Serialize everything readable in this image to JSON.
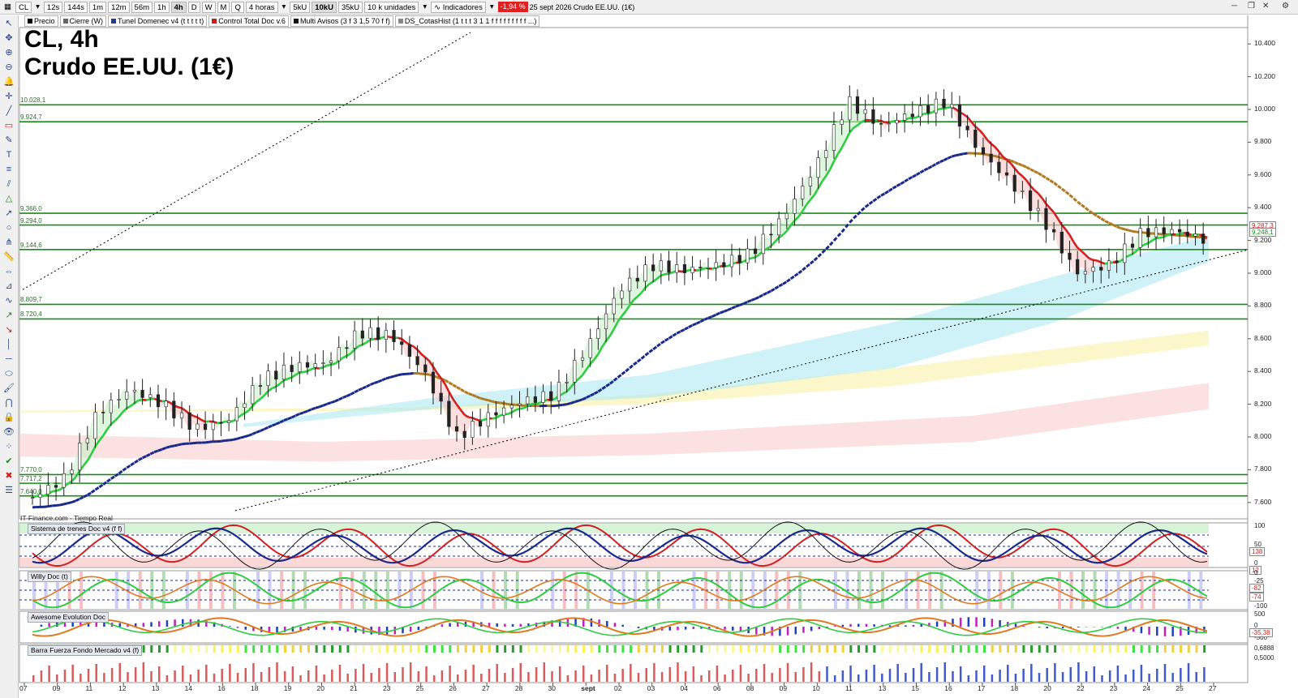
{
  "toolbar": {
    "symbol": "CL",
    "timeframes": [
      "12s",
      "144s",
      "1m",
      "12m",
      "56m",
      "1h",
      "4h",
      "D",
      "W",
      "M",
      "Q"
    ],
    "active_timeframe": "4h",
    "period_select": "4 horas",
    "unit_buttons": [
      "5kU",
      "10kU",
      "35kU"
    ],
    "active_unit": "10kU",
    "units_select": "10 k unidades",
    "indicators_label": "Indicadores",
    "change_badge": "-1,94 %",
    "date_text": "25 sept 2026",
    "instrument_text": "Crudo EE.UU. (1€)",
    "overlays": [
      {
        "label": "Precio",
        "color": "#000000"
      },
      {
        "label": "Cierre (W)",
        "color": "#666666"
      },
      {
        "label": "Tunel Domenec v4 (t t t t t)",
        "color": "#2a3a8a"
      },
      {
        "label": "Control Total Doc v.6",
        "color": "#c02020"
      },
      {
        "label": "Multi Avisos (3 f 3 1,5 70 f f)",
        "color": "#111111"
      },
      {
        "label": "DS_CotasHist (1 t t t 3 1 1 f f f f f f f f f ...)",
        "color": "#888888"
      }
    ]
  },
  "chart": {
    "title_line1": "CL, 4h",
    "title_line2": "Crudo EE.UU. (1€)",
    "source": "IT-Finance.com - Tiempo Real",
    "price_ticks": [
      "10.400",
      "10.200",
      "10.000",
      "9.800",
      "9.600",
      "9.400",
      "9.200",
      "9.000",
      "8.800",
      "8.600",
      "8.400",
      "8.200",
      "8.000",
      "7.800",
      "7.600"
    ],
    "levels": [
      "10.028,1",
      "9.924,7",
      "9.366,0",
      "9.294,0",
      "9.144,6",
      "8.809,7",
      "8.720,4",
      "7.770,0",
      "7.717,2",
      "7.640,0"
    ],
    "price_tags": [
      "9.287,3",
      "9.248,1"
    ],
    "date_ticks": [
      "07",
      "09",
      "11",
      "12",
      "13",
      "14",
      "16",
      "18",
      "19",
      "20",
      "21",
      "23",
      "25",
      "26",
      "27",
      "28",
      "30",
      "sept",
      "02",
      "03",
      "04",
      "06",
      "08",
      "09",
      "10",
      "11",
      "13",
      "15",
      "16",
      "17",
      "18",
      "20",
      "22",
      "23",
      "24",
      "25",
      "27"
    ],
    "colors": {
      "support": "#1a8a1a",
      "bull": "#2ecc40",
      "bear": "#d02020",
      "trend": "#1a2a8a",
      "ema": "#b07a20"
    }
  },
  "chart_data": [
    {
      "type": "candlestick",
      "title": "CL, 4h",
      "subtitle": "Crudo EE.UU. (1€)",
      "ylim": [
        7500,
        10500
      ],
      "x": [
        "07",
        "09",
        "11",
        "12",
        "13",
        "14",
        "16",
        "18",
        "19",
        "20",
        "21",
        "23",
        "25",
        "26",
        "27",
        "28",
        "30",
        "sept",
        "02",
        "03",
        "04",
        "06",
        "08",
        "09",
        "10",
        "11",
        "13",
        "15",
        "16",
        "17",
        "18",
        "20",
        "22",
        "23",
        "24",
        "25",
        "27"
      ],
      "close": [
        7630,
        7750,
        8150,
        8290,
        8200,
        8050,
        8100,
        8350,
        8430,
        8450,
        8640,
        8620,
        8400,
        8000,
        8130,
        8220,
        8260,
        8550,
        8900,
        9050,
        9020,
        9050,
        9120,
        9340,
        9650,
        10050,
        9900,
        9980,
        10050,
        9750,
        9550,
        9320,
        9000,
        9050,
        9250,
        9260,
        9200
      ]
    },
    {
      "type": "line",
      "title": "Sistema de trenes Doc v4 (f f)",
      "ylim": [
        0,
        100
      ],
      "ticks": [
        "100",
        "50",
        "0"
      ],
      "value_tags": [
        "138",
        "12"
      ]
    },
    {
      "type": "line",
      "title": "Willy Doc (t)",
      "ylim": [
        -100,
        0
      ],
      "ticks": [
        "0",
        "-25",
        "-50",
        "-75",
        "-100"
      ],
      "value_tags": [
        "-82",
        "-74"
      ]
    },
    {
      "type": "bar",
      "title": "Awesome Evolution Doc",
      "ticks": [
        "500",
        "0",
        "-500"
      ],
      "value_tags": [
        "-35,38"
      ]
    },
    {
      "type": "bar",
      "title": "Barra Fuerza Fondo Mercado v4 (f)",
      "ticks": [
        "0,6888",
        "0,5000"
      ]
    }
  ]
}
